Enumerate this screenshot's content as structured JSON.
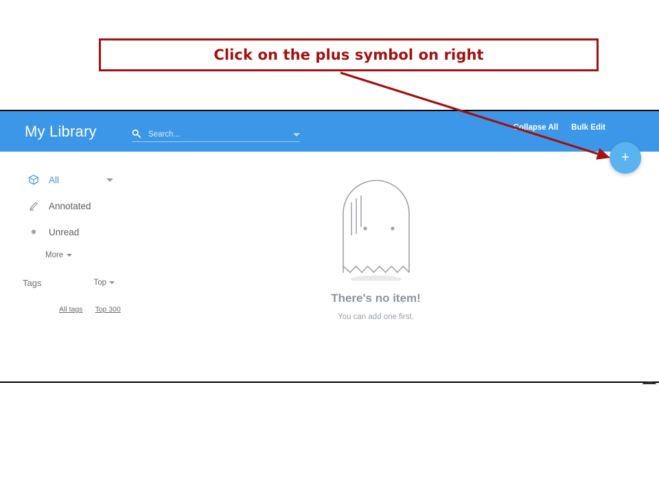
{
  "annotation": {
    "callout_text": "Click on the plus symbol on right",
    "border_color": "#a31010",
    "arrow_color": "#a31010"
  },
  "app": {
    "header": {
      "title": "My Library",
      "background_color": "#3d97e8",
      "search": {
        "icon": "search-icon",
        "placeholder": "Search...",
        "value": "",
        "dropdown_icon": "chevron-down-icon"
      },
      "actions": [
        {
          "label": "Collapse All",
          "name": "collapse-all"
        },
        {
          "label": "Bulk Edit",
          "name": "bulk-edit"
        }
      ],
      "add_button": {
        "glyph": "+",
        "icon": "plus-icon",
        "background_color": "#59b3ef"
      }
    },
    "sidebar": {
      "items": [
        {
          "label": "All",
          "icon": "cube-icon",
          "active": true,
          "has_chevron": true
        },
        {
          "label": "Annotated",
          "icon": "pencil-icon",
          "active": false,
          "has_chevron": false
        },
        {
          "label": "Unread",
          "icon": "dot-icon",
          "active": false,
          "has_chevron": false
        }
      ],
      "more_label": "More",
      "tags": {
        "label": "Tags",
        "sort_label": "Top",
        "links": [
          {
            "label": "All tags"
          },
          {
            "label": "Top 300"
          }
        ]
      }
    },
    "empty_state": {
      "illustration": "ghost-illustration",
      "title": "There's no item!",
      "subtitle": "You can add one first."
    }
  }
}
